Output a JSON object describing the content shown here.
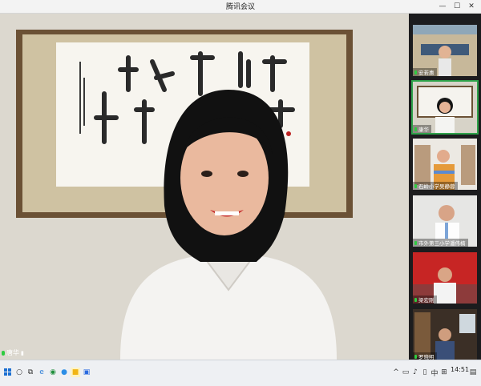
{
  "window": {
    "title": "腾讯会议",
    "minimize": "—",
    "maximize": "☐",
    "close": "✕"
  },
  "main": {
    "speaker_name": "唐华"
  },
  "participants": [
    {
      "name": "安若惠"
    },
    {
      "name": "康华"
    },
    {
      "name": "石岭小学吴静蓉"
    },
    {
      "name": "市外第三小学潘伟楠"
    },
    {
      "name": "梁宏刚"
    },
    {
      "name": "罗晓明"
    }
  ],
  "taskbar": {
    "clock": "14:51",
    "ime": "中"
  }
}
